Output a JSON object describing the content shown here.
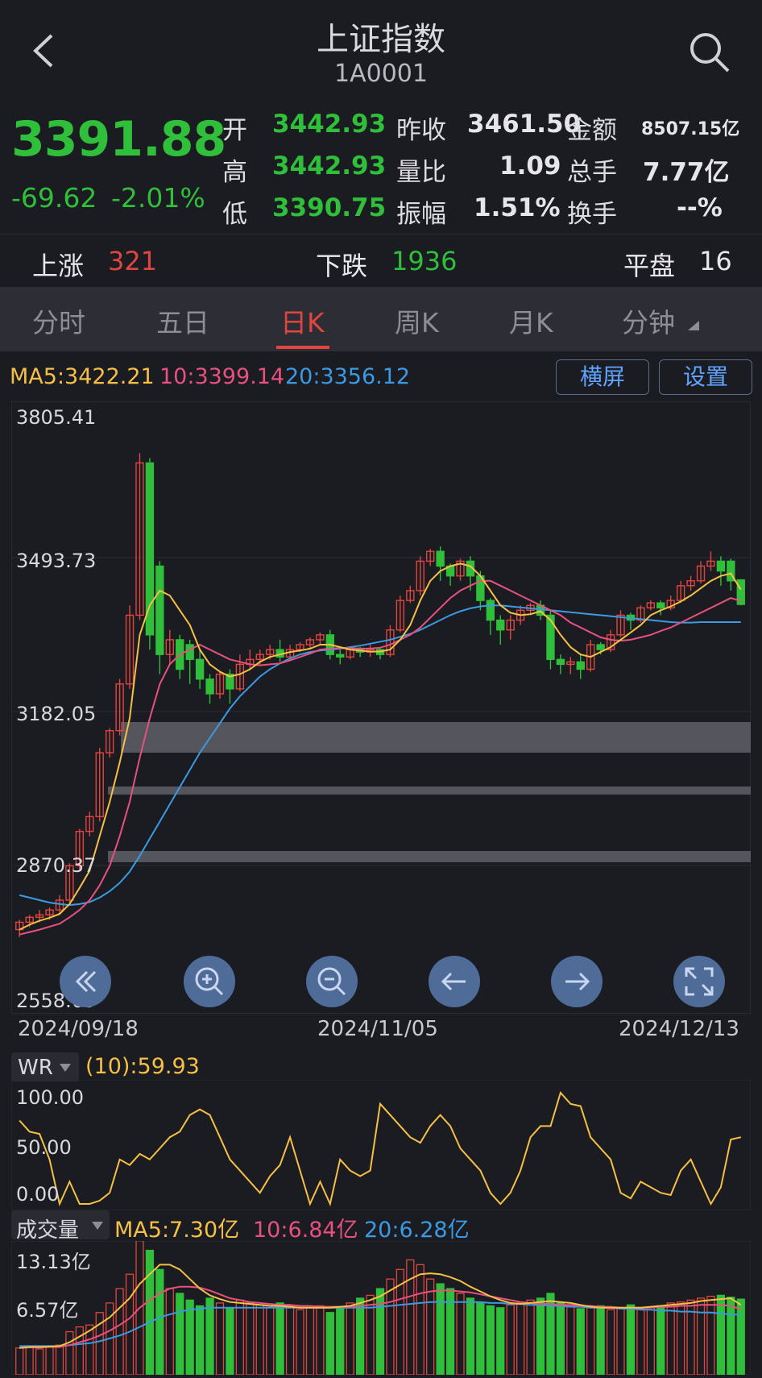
{
  "header": {
    "title": "上证指数",
    "code": "1A0001"
  },
  "quote": {
    "price": "3391.88",
    "change": "-69.62",
    "change_pct": "-2.01%",
    "open_label": "开",
    "open": "3442.93",
    "high_label": "高",
    "high": "3442.93",
    "low_label": "低",
    "low": "3390.75",
    "prev_close_label": "昨收",
    "prev_close": "3461.50",
    "vol_ratio_label": "量比",
    "vol_ratio": "1.09",
    "amplitude_label": "振幅",
    "amplitude": "1.51%",
    "amount_label": "金额",
    "amount": "8507.15亿",
    "total_hands_label": "总手",
    "total_hands": "7.77亿",
    "turnover_label": "换手",
    "turnover": "--%"
  },
  "breadth": {
    "up_label": "上涨",
    "up": "321",
    "down_label": "下跌",
    "down": "1936",
    "flat_label": "平盘",
    "flat": "16"
  },
  "tabs": [
    "分时",
    "五日",
    "日K",
    "周K",
    "月K",
    "分钟"
  ],
  "active_tab": "日K",
  "ma": {
    "ma5": "MA5:3422.21",
    "ma10": "10:3399.14",
    "ma20": "20:3356.12"
  },
  "buttons": {
    "landscape": "横屏",
    "settings": "设置"
  },
  "chart_data": [
    {
      "type": "candlestick",
      "y_ticks": [
        "3805.41",
        "3493.73",
        "3182.05",
        "2870.37",
        "2558.69"
      ],
      "ylim": [
        2558.69,
        3805.41
      ],
      "x_labels": [
        "2024/09/18",
        "2024/11/05",
        "2024/12/13"
      ],
      "candles": [
        [
          2730,
          2745,
          2715,
          2750
        ],
        [
          2745,
          2755,
          2735,
          2760
        ],
        [
          2755,
          2760,
          2745,
          2770
        ],
        [
          2760,
          2770,
          2750,
          2775
        ],
        [
          2770,
          2790,
          2760,
          2800
        ],
        [
          2790,
          2860,
          2785,
          2865
        ],
        [
          2860,
          2930,
          2850,
          2935
        ],
        [
          2930,
          2960,
          2920,
          2970
        ],
        [
          2960,
          3090,
          2950,
          3100
        ],
        [
          3090,
          3135,
          3080,
          3140
        ],
        [
          3135,
          3230,
          3125,
          3240
        ],
        [
          3230,
          3370,
          3220,
          3390
        ],
        [
          3370,
          3680,
          3360,
          3700
        ],
        [
          3680,
          3330,
          3300,
          3690
        ],
        [
          3470,
          3290,
          3250,
          3480
        ],
        [
          3290,
          3320,
          3270,
          3340
        ],
        [
          3320,
          3260,
          3240,
          3330
        ],
        [
          3310,
          3280,
          3230,
          3320
        ],
        [
          3280,
          3240,
          3220,
          3300
        ],
        [
          3240,
          3210,
          3190,
          3250
        ],
        [
          3210,
          3250,
          3200,
          3255
        ],
        [
          3250,
          3220,
          3190,
          3260
        ],
        [
          3220,
          3270,
          3215,
          3290
        ],
        [
          3270,
          3280,
          3260,
          3300
        ],
        [
          3280,
          3290,
          3270,
          3300
        ],
        [
          3290,
          3300,
          3280,
          3310
        ],
        [
          3300,
          3285,
          3275,
          3320
        ],
        [
          3285,
          3300,
          3280,
          3310
        ],
        [
          3300,
          3310,
          3295,
          3315
        ],
        [
          3310,
          3320,
          3300,
          3325
        ],
        [
          3320,
          3330,
          3310,
          3335
        ],
        [
          3330,
          3290,
          3280,
          3340
        ],
        [
          3290,
          3285,
          3270,
          3300
        ],
        [
          3285,
          3300,
          3280,
          3305
        ],
        [
          3300,
          3295,
          3285,
          3305
        ],
        [
          3295,
          3300,
          3285,
          3310
        ],
        [
          3300,
          3290,
          3280,
          3305
        ],
        [
          3290,
          3340,
          3285,
          3350
        ],
        [
          3340,
          3400,
          3335,
          3410
        ],
        [
          3400,
          3420,
          3395,
          3430
        ],
        [
          3420,
          3480,
          3410,
          3490
        ],
        [
          3480,
          3500,
          3470,
          3505
        ],
        [
          3500,
          3470,
          3440,
          3510
        ],
        [
          3470,
          3450,
          3430,
          3475
        ],
        [
          3450,
          3480,
          3440,
          3485
        ],
        [
          3480,
          3450,
          3420,
          3490
        ],
        [
          3450,
          3400,
          3380,
          3460
        ],
        [
          3400,
          3360,
          3330,
          3405
        ],
        [
          3360,
          3340,
          3310,
          3370
        ],
        [
          3340,
          3360,
          3320,
          3370
        ],
        [
          3360,
          3380,
          3350,
          3390
        ],
        [
          3380,
          3390,
          3370,
          3395
        ],
        [
          3390,
          3370,
          3360,
          3400
        ],
        [
          3370,
          3280,
          3260,
          3380
        ],
        [
          3280,
          3270,
          3250,
          3290
        ],
        [
          3270,
          3275,
          3250,
          3285
        ],
        [
          3275,
          3260,
          3240,
          3290
        ],
        [
          3260,
          3310,
          3255,
          3320
        ],
        [
          3310,
          3300,
          3290,
          3315
        ],
        [
          3300,
          3330,
          3295,
          3340
        ],
        [
          3330,
          3370,
          3325,
          3380
        ],
        [
          3370,
          3360,
          3340,
          3375
        ],
        [
          3360,
          3385,
          3355,
          3390
        ],
        [
          3385,
          3395,
          3380,
          3400
        ],
        [
          3395,
          3385,
          3370,
          3400
        ],
        [
          3385,
          3400,
          3380,
          3410
        ],
        [
          3400,
          3430,
          3395,
          3440
        ],
        [
          3430,
          3440,
          3420,
          3450
        ],
        [
          3440,
          3470,
          3435,
          3480
        ],
        [
          3470,
          3480,
          3460,
          3500
        ],
        [
          3480,
          3460,
          3430,
          3490
        ],
        [
          3480,
          3440,
          3420,
          3485
        ],
        [
          3442,
          3392,
          3390,
          3443
        ]
      ],
      "ma5": [
        2730,
        2740,
        2748,
        2754,
        2762,
        2782,
        2815,
        2850,
        2920,
        2990,
        3070,
        3160,
        3330,
        3390,
        3420,
        3410,
        3380,
        3350,
        3300,
        3270,
        3255,
        3245,
        3250,
        3260,
        3275,
        3285,
        3290,
        3295,
        3298,
        3302,
        3310,
        3310,
        3305,
        3300,
        3298,
        3296,
        3296,
        3300,
        3320,
        3350,
        3400,
        3440,
        3460,
        3470,
        3475,
        3470,
        3450,
        3420,
        3390,
        3375,
        3370,
        3372,
        3378,
        3360,
        3330,
        3305,
        3290,
        3285,
        3295,
        3305,
        3320,
        3335,
        3350,
        3370,
        3380,
        3388,
        3398,
        3410,
        3425,
        3440,
        3450,
        3455,
        3422
      ],
      "ma10": [
        2720,
        2725,
        2730,
        2736,
        2742,
        2755,
        2770,
        2790,
        2820,
        2860,
        2920,
        2990,
        3080,
        3160,
        3230,
        3270,
        3290,
        3300,
        3310,
        3300,
        3290,
        3280,
        3275,
        3270,
        3268,
        3270,
        3272,
        3278,
        3285,
        3292,
        3300,
        3302,
        3303,
        3303,
        3302,
        3302,
        3304,
        3310,
        3320,
        3330,
        3345,
        3365,
        3385,
        3405,
        3420,
        3430,
        3440,
        3440,
        3430,
        3420,
        3410,
        3400,
        3390,
        3380,
        3370,
        3355,
        3345,
        3335,
        3325,
        3320,
        3318,
        3320,
        3325,
        3330,
        3338,
        3345,
        3355,
        3365,
        3375,
        3385,
        3395,
        3405,
        3399
      ],
      "ma20": [
        2800,
        2795,
        2790,
        2785,
        2782,
        2780,
        2782,
        2786,
        2795,
        2808,
        2825,
        2848,
        2880,
        2915,
        2950,
        2985,
        3020,
        3055,
        3090,
        3120,
        3150,
        3180,
        3205,
        3225,
        3245,
        3260,
        3272,
        3282,
        3290,
        3295,
        3298,
        3300,
        3302,
        3305,
        3308,
        3312,
        3316,
        3320,
        3326,
        3332,
        3340,
        3350,
        3360,
        3370,
        3378,
        3384,
        3388,
        3390,
        3390,
        3388,
        3386,
        3384,
        3382,
        3380,
        3378,
        3376,
        3374,
        3372,
        3370,
        3368,
        3366,
        3364,
        3362,
        3360,
        3358,
        3356,
        3355,
        3355,
        3356,
        3356,
        3356,
        3356,
        3356
      ]
    },
    {
      "type": "line",
      "indicator_label": "WR",
      "param_label": "(10):59.93",
      "y_ticks": [
        "100.00",
        "50.00",
        "0.00"
      ],
      "ylim": [
        0,
        100
      ],
      "values": [
        75,
        65,
        63,
        40,
        0,
        20,
        0,
        0,
        3,
        10,
        40,
        35,
        45,
        40,
        50,
        60,
        65,
        80,
        85,
        80,
        60,
        40,
        30,
        20,
        10,
        25,
        35,
        60,
        30,
        0,
        20,
        0,
        40,
        30,
        25,
        30,
        90,
        80,
        70,
        60,
        55,
        70,
        80,
        70,
        50,
        40,
        30,
        10,
        0,
        10,
        30,
        60,
        70,
        70,
        100,
        90,
        88,
        60,
        50,
        40,
        10,
        5,
        20,
        15,
        10,
        8,
        30,
        40,
        20,
        0,
        15,
        58,
        60
      ]
    },
    {
      "type": "bar",
      "indicator_label": "成交量",
      "ma5": "MA5:7.30亿",
      "ma10": "10:6.84亿",
      "ma20": "20:6.28亿",
      "y_ticks": [
        "13.13亿",
        "6.57亿"
      ],
      "ylim": [
        0,
        13.13
      ],
      "values": [
        2.8,
        2.9,
        2.7,
        3,
        3.1,
        4.5,
        5,
        5.2,
        6.5,
        7.5,
        9,
        10.5,
        14,
        13,
        11,
        9,
        8.5,
        7.8,
        7.2,
        8,
        7.5,
        7,
        7.8,
        7.5,
        7.3,
        7,
        7.5,
        7.2,
        6.8,
        7,
        7.2,
        6.5,
        7,
        7.5,
        8,
        8.3,
        9,
        10,
        11,
        12,
        11.5,
        10,
        9.5,
        9,
        8.5,
        8,
        7.5,
        7.2,
        7,
        7.3,
        7.5,
        7.8,
        8,
        8.5,
        7.5,
        7.2,
        6.9,
        7,
        7.2,
        6.8,
        7,
        7.3,
        6.9,
        7.1,
        7.2,
        7.5,
        7.6,
        7.8,
        8,
        8.2,
        8.3,
        8.1,
        7.9
      ],
      "ma5_line": [
        2.8,
        2.9,
        2.9,
        2.95,
        3,
        3.4,
        4,
        4.6,
        5.3,
        6,
        7,
        8,
        9.5,
        10.5,
        11.5,
        11.5,
        11,
        10,
        9,
        8.3,
        7.9,
        7.6,
        7.5,
        7.4,
        7.3,
        7.2,
        7.2,
        7.1,
        7,
        7,
        7,
        7,
        7.1,
        7.2,
        7.5,
        7.8,
        8.2,
        8.8,
        9.4,
        10,
        10.5,
        10.6,
        10.5,
        10.2,
        9.8,
        9.2,
        8.7,
        8.2,
        7.8,
        7.5,
        7.4,
        7.5,
        7.6,
        7.7,
        7.6,
        7.5,
        7.3,
        7.1,
        7,
        7,
        7,
        7,
        7,
        7.1,
        7.2,
        7.3,
        7.4,
        7.5,
        7.7,
        7.8,
        7.9,
        8,
        7.3
      ],
      "ma10_line": [
        2.8,
        2.85,
        2.85,
        2.9,
        2.9,
        3.1,
        3.4,
        3.7,
        4.1,
        4.6,
        5.2,
        5.9,
        7,
        7.8,
        8.5,
        9,
        9.2,
        9.2,
        9.1,
        8.8,
        8.4,
        8,
        7.8,
        7.6,
        7.5,
        7.4,
        7.3,
        7.3,
        7.2,
        7.2,
        7.1,
        7.1,
        7.1,
        7.1,
        7.2,
        7.3,
        7.4,
        7.6,
        7.9,
        8.2,
        8.5,
        8.7,
        8.8,
        8.8,
        8.7,
        8.6,
        8.4,
        8.2,
        8,
        7.8,
        7.6,
        7.5,
        7.4,
        7.4,
        7.3,
        7.3,
        7.2,
        7.2,
        7.1,
        7.1,
        7,
        7,
        7,
        7,
        7.1,
        7.1,
        7.2,
        7.2,
        7.3,
        7.3,
        7.3,
        7.2,
        6.84
      ],
      "ma20_line": [
        3,
        3,
        3,
        3,
        3,
        3.1,
        3.2,
        3.3,
        3.5,
        3.8,
        4.1,
        4.5,
        5,
        5.5,
        6,
        6.3,
        6.6,
        6.8,
        6.9,
        7,
        7,
        7,
        7,
        7,
        7,
        7,
        7,
        7,
        7,
        7,
        7,
        7,
        7,
        7,
        7,
        7,
        7.1,
        7.2,
        7.3,
        7.4,
        7.5,
        7.6,
        7.6,
        7.6,
        7.6,
        7.6,
        7.6,
        7.5,
        7.5,
        7.4,
        7.4,
        7.3,
        7.3,
        7.2,
        7.2,
        7.1,
        7.1,
        7,
        7,
        7,
        6.9,
        6.9,
        6.8,
        6.8,
        6.7,
        6.7,
        6.6,
        6.6,
        6.5,
        6.5,
        6.4,
        6.3,
        6.28
      ]
    }
  ],
  "wr": {
    "label": "WR",
    "param": "(10):59.93",
    "t100": "100.00",
    "t50": "50.00",
    "t0": "0.00"
  },
  "vol": {
    "label": "成交量",
    "ma5": "MA5:7.30亿",
    "ma10": "10:6.84亿",
    "ma20": "20:6.28亿",
    "t1": "13.13亿",
    "t2": "6.57亿"
  },
  "colors": {
    "up": "#e0463f",
    "down": "#2fbf3a",
    "ma5": "#f5c044",
    "ma10": "#e8507e",
    "ma20": "#3b9ae1",
    "bg": "#1b1b22"
  }
}
